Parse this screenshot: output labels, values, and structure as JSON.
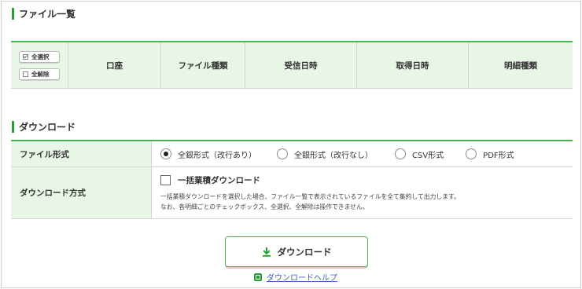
{
  "file_list": {
    "title": "ファイル一覧",
    "select_all_label": "全選択",
    "clear_all_label": "全解除",
    "columns": [
      "口座",
      "ファイル種類",
      "受信日時",
      "取得日時",
      "明細種類"
    ]
  },
  "download": {
    "title": "ダウンロード",
    "format_label": "ファイル形式",
    "format_options": [
      {
        "label": "全銀形式（改行あり）",
        "selected": true
      },
      {
        "label": "全銀形式（改行なし）",
        "selected": false
      },
      {
        "label": "CSV形式",
        "selected": false
      },
      {
        "label": "PDF形式",
        "selected": false
      }
    ],
    "method_label": "ダウンロード方式",
    "bulk_label": "一括業積ダウンロード",
    "note_line1": "一括業積ダウンロードを選択した場合、ファイル一覧で表示されているファイルを全て集約して出力します。",
    "note_line2": "なお、各明細ごとのチェックボックス、全選択、全解除は操作できません。",
    "button_label": "ダウンロード",
    "help_label": "ダウンロードヘルプ"
  },
  "colors": {
    "accent": "#4ab352",
    "header_bg": "#e8f6e6",
    "link": "#3b5fc4"
  }
}
